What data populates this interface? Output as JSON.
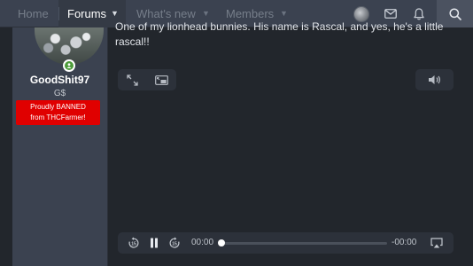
{
  "nav": {
    "items": [
      {
        "label": "Home"
      },
      {
        "label": "Forums"
      },
      {
        "label": "What's new"
      },
      {
        "label": "Members"
      }
    ],
    "caret": "▼"
  },
  "user": {
    "name": "GoodShit97",
    "title": "G$",
    "banner_line1": "Proudly BANNED",
    "banner_line2": "from THCFarmer!"
  },
  "message": {
    "text": "One of my lionhead bunnies. His name is Rascal, and yes, he's a little rascal!!"
  },
  "player": {
    "current_time": "00:00",
    "remaining_time": "-00:00",
    "progress": 0
  },
  "colors": {
    "nav_bg": "#3b4250",
    "page_bg": "#22262c",
    "banner_red": "#e00000",
    "online_green": "#4d9c3a"
  }
}
